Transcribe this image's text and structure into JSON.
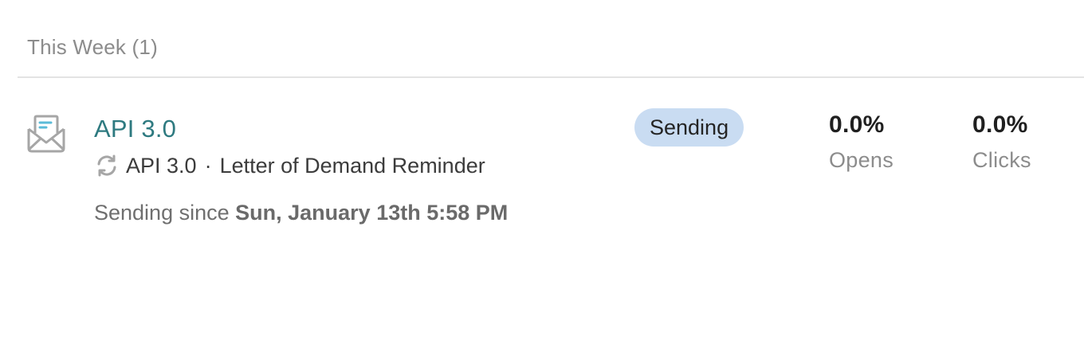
{
  "section": {
    "title": "This Week (1)"
  },
  "campaign": {
    "icon": "envelope-open-icon",
    "name": "API 3.0",
    "subtitle_icon": "repeat-icon",
    "subtitle_part1": "API 3.0",
    "subtitle_separator": "·",
    "subtitle_part2": "Letter of Demand Reminder",
    "since_label": "Sending since",
    "since_date": "Sun, January 13th 5:58 PM",
    "status": "Sending",
    "stats": {
      "opens_value": "0.0%",
      "opens_label": "Opens",
      "clicks_value": "0.0%",
      "clicks_label": "Clicks"
    }
  },
  "colors": {
    "link": "#2e7a80",
    "badge_bg": "#c9dcf2",
    "icon_accent": "#5bbbd8",
    "icon_stroke": "#a6a6a6"
  }
}
